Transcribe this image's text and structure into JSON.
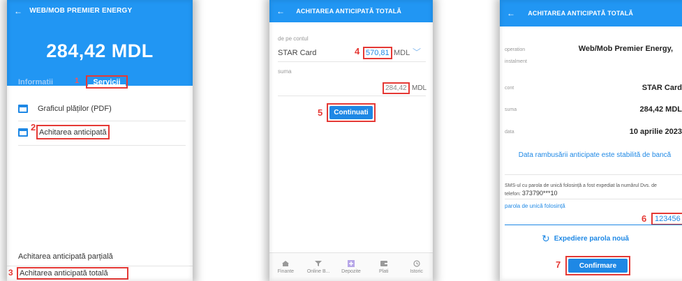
{
  "screen1": {
    "title": "WEB/MOB PREMIER ENERGY",
    "amount": "284,42 MDL",
    "tabs": {
      "info": "Informatii",
      "services": "Servicii"
    },
    "menu": {
      "schedule": "Graficul plăților (PDF)",
      "early_payment": "Achitarea anticipată"
    },
    "bottom": {
      "partial": "Achitarea anticipată parțială",
      "total": "Achitarea anticipată totală"
    },
    "steps": {
      "s1": "1",
      "s2": "2",
      "s3": "3"
    }
  },
  "screen2": {
    "title": "ACHITAREA ANTICIPATĂ TOTALĂ",
    "from_label": "de pe contul",
    "account": "STAR Card",
    "balance": "570,81",
    "currency": "MDL",
    "sum_label": "suma",
    "sum": "284,42",
    "sum_currency": "MDL",
    "continue_button": "Continuati",
    "steps": {
      "s4": "4",
      "s5": "5"
    },
    "nav": [
      {
        "label": "Finante",
        "icon": "home-icon"
      },
      {
        "label": "Online B...",
        "icon": "filter-icon"
      },
      {
        "label": "Depozite",
        "icon": "plus-icon"
      },
      {
        "label": "Plati",
        "icon": "wallet-icon"
      },
      {
        "label": "Istoric",
        "icon": "history-icon"
      }
    ]
  },
  "screen3": {
    "title": "ACHITAREA ANTICIPATĂ TOTALĂ",
    "operation_label": "operation",
    "instalment_label": "instalment",
    "operation_value": "Web/Mob Premier Energy,",
    "cont_label": "cont",
    "cont_value": "STAR Card",
    "suma_label": "suma",
    "suma_value": "284,42 MDL",
    "data_label": "data",
    "data_value": "10 aprilie 2023",
    "info_text": "Data rambusării anticipate este stabilită de bancă",
    "sms_text": "SMS-ul cu parola de unică folosință a fost expediat la numărul Dvs. de telefon:",
    "phone": "373790***10",
    "otp_label": "parola de unică folosință",
    "otp_value": "123456",
    "resend": "Expediere parola nouă",
    "confirm_button": "Confirmare",
    "steps": {
      "s6": "6",
      "s7": "7"
    }
  },
  "colors": {
    "primary": "#2196f3",
    "highlight": "#e53935"
  }
}
